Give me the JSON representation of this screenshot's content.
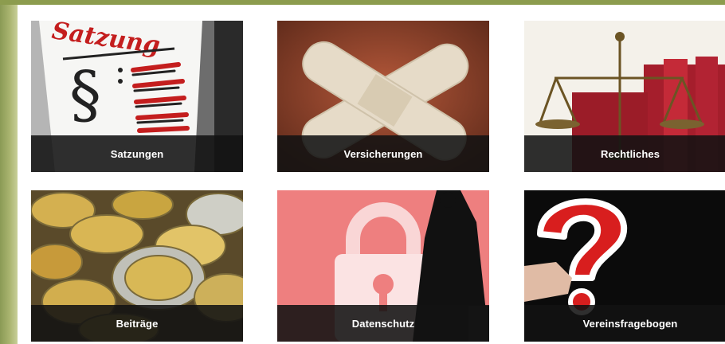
{
  "tiles": [
    {
      "label": "Satzungen",
      "image_text": "Satzung"
    },
    {
      "label": "Versicherungen"
    },
    {
      "label": "Rechtliches"
    },
    {
      "label": "Beiträge"
    },
    {
      "label": "Datenschutz"
    },
    {
      "label": "Vereinsfragebogen"
    }
  ],
  "colors": {
    "accent_bar": "#8c9c4e",
    "caption_bg": "#121212"
  }
}
